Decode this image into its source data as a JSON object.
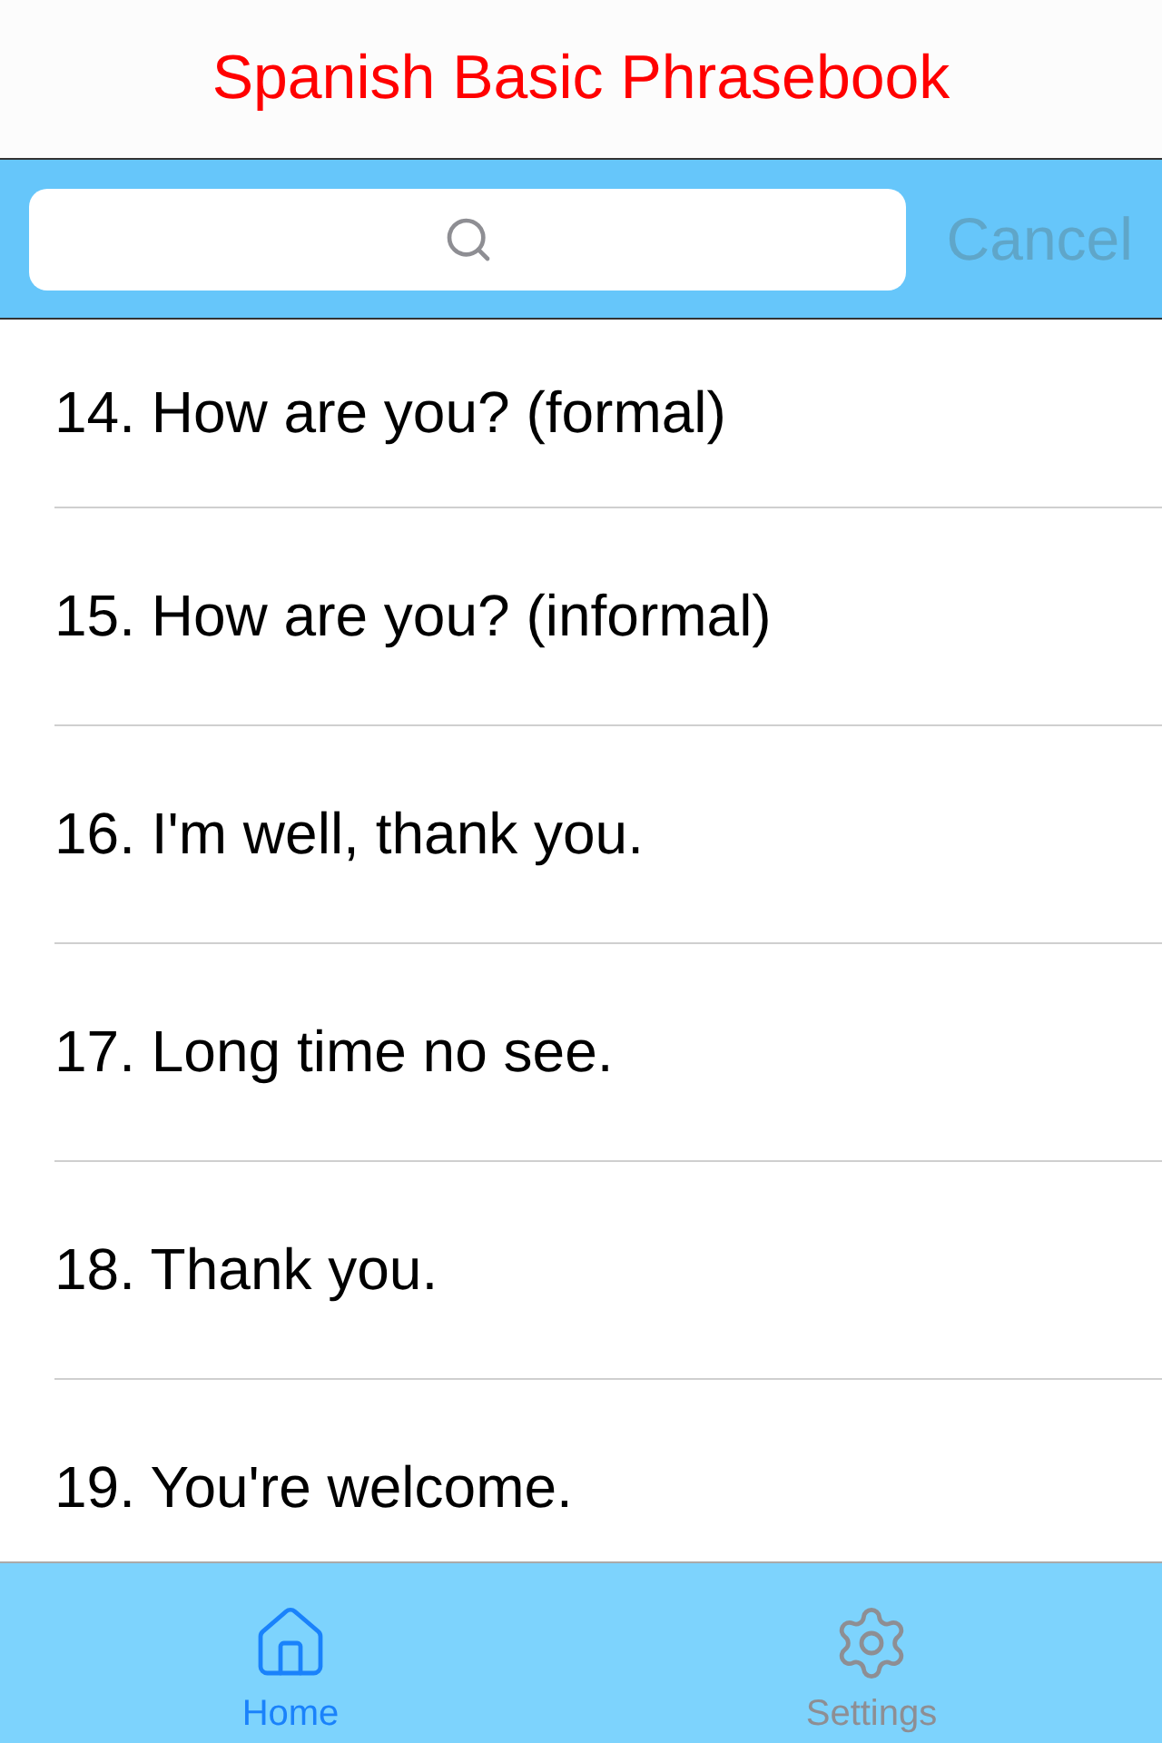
{
  "title": "Spanish Basic Phrasebook",
  "search": {
    "cancel": "Cancel"
  },
  "phrases": [
    "14. How are you? (formal)",
    "15. How are you? (informal)",
    "16. I'm well, thank you.",
    "17. Long time no see.",
    "18. Thank you.",
    "19. You're welcome."
  ],
  "tabs": [
    {
      "label": "Home",
      "kind": "home",
      "selected": true
    },
    {
      "label": "Settings",
      "kind": "settings",
      "selected": false
    }
  ]
}
